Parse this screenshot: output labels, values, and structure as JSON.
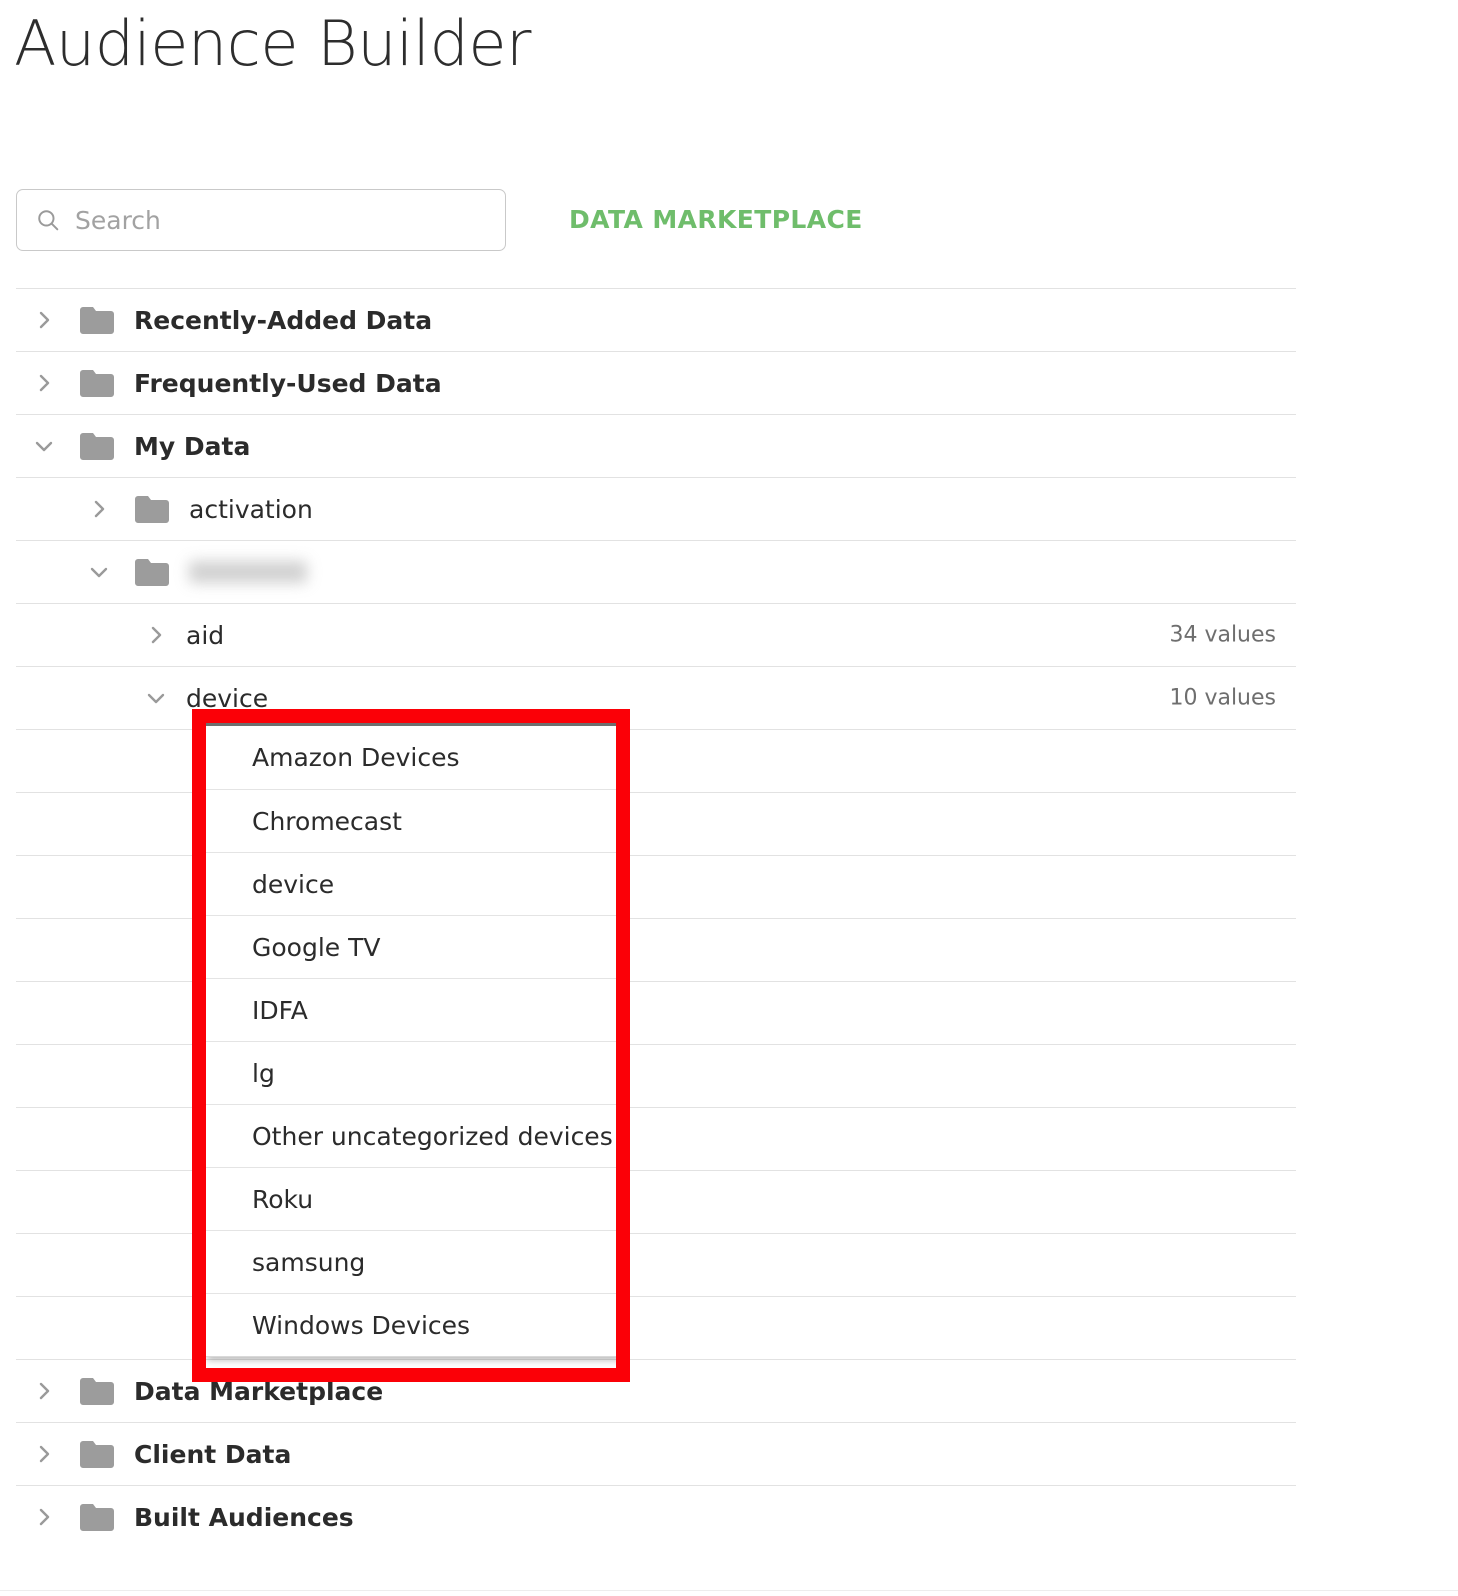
{
  "header": {
    "title": "Audience Builder"
  },
  "search": {
    "placeholder": "Search",
    "value": "",
    "icon": "search-icon"
  },
  "marketplace": {
    "label": "DATA MARKETPLACE",
    "color": "#6fbd6b"
  },
  "tree": {
    "rows": [
      {
        "label": "Recently-Added Data",
        "level": 0,
        "expanded": false,
        "chevron": "chevron-right-icon",
        "folder": true,
        "bold": true,
        "count": ""
      },
      {
        "label": "Frequently-Used Data",
        "level": 0,
        "expanded": false,
        "chevron": "chevron-right-icon",
        "folder": true,
        "bold": true,
        "count": ""
      },
      {
        "label": "My Data",
        "level": 0,
        "expanded": true,
        "chevron": "chevron-down-icon",
        "folder": true,
        "bold": true,
        "count": ""
      },
      {
        "label": "activation",
        "level": 1,
        "expanded": false,
        "chevron": "chevron-right-icon",
        "folder": true,
        "bold": false,
        "count": ""
      },
      {
        "label": "",
        "level": 1,
        "expanded": true,
        "chevron": "chevron-down-icon",
        "folder": true,
        "bold": false,
        "count": "",
        "redacted": true
      },
      {
        "label": "aid",
        "level": 2,
        "expanded": false,
        "chevron": "chevron-right-icon",
        "folder": false,
        "bold": false,
        "count": "34 values"
      },
      {
        "label": "device",
        "level": 2,
        "expanded": true,
        "chevron": "chevron-down-icon",
        "folder": false,
        "bold": false,
        "count": "10 values"
      }
    ],
    "footer_rows": [
      {
        "label": "Data Marketplace",
        "level": 0,
        "expanded": false,
        "chevron": "chevron-right-icon",
        "folder": true,
        "bold": true,
        "count": ""
      },
      {
        "label": "Client Data",
        "level": 0,
        "expanded": false,
        "chevron": "chevron-right-icon",
        "folder": true,
        "bold": true,
        "count": ""
      },
      {
        "label": "Built Audiences",
        "level": 0,
        "expanded": false,
        "chevron": "chevron-right-icon",
        "folder": true,
        "bold": true,
        "count": ""
      }
    ]
  },
  "device_values": {
    "highlight_color": "#fb0007",
    "items": [
      "Amazon Devices",
      "Chromecast",
      "device",
      "Google TV",
      "IDFA",
      "lg",
      "Other uncategorized devices",
      "Roku",
      "samsung",
      "Windows Devices"
    ]
  }
}
